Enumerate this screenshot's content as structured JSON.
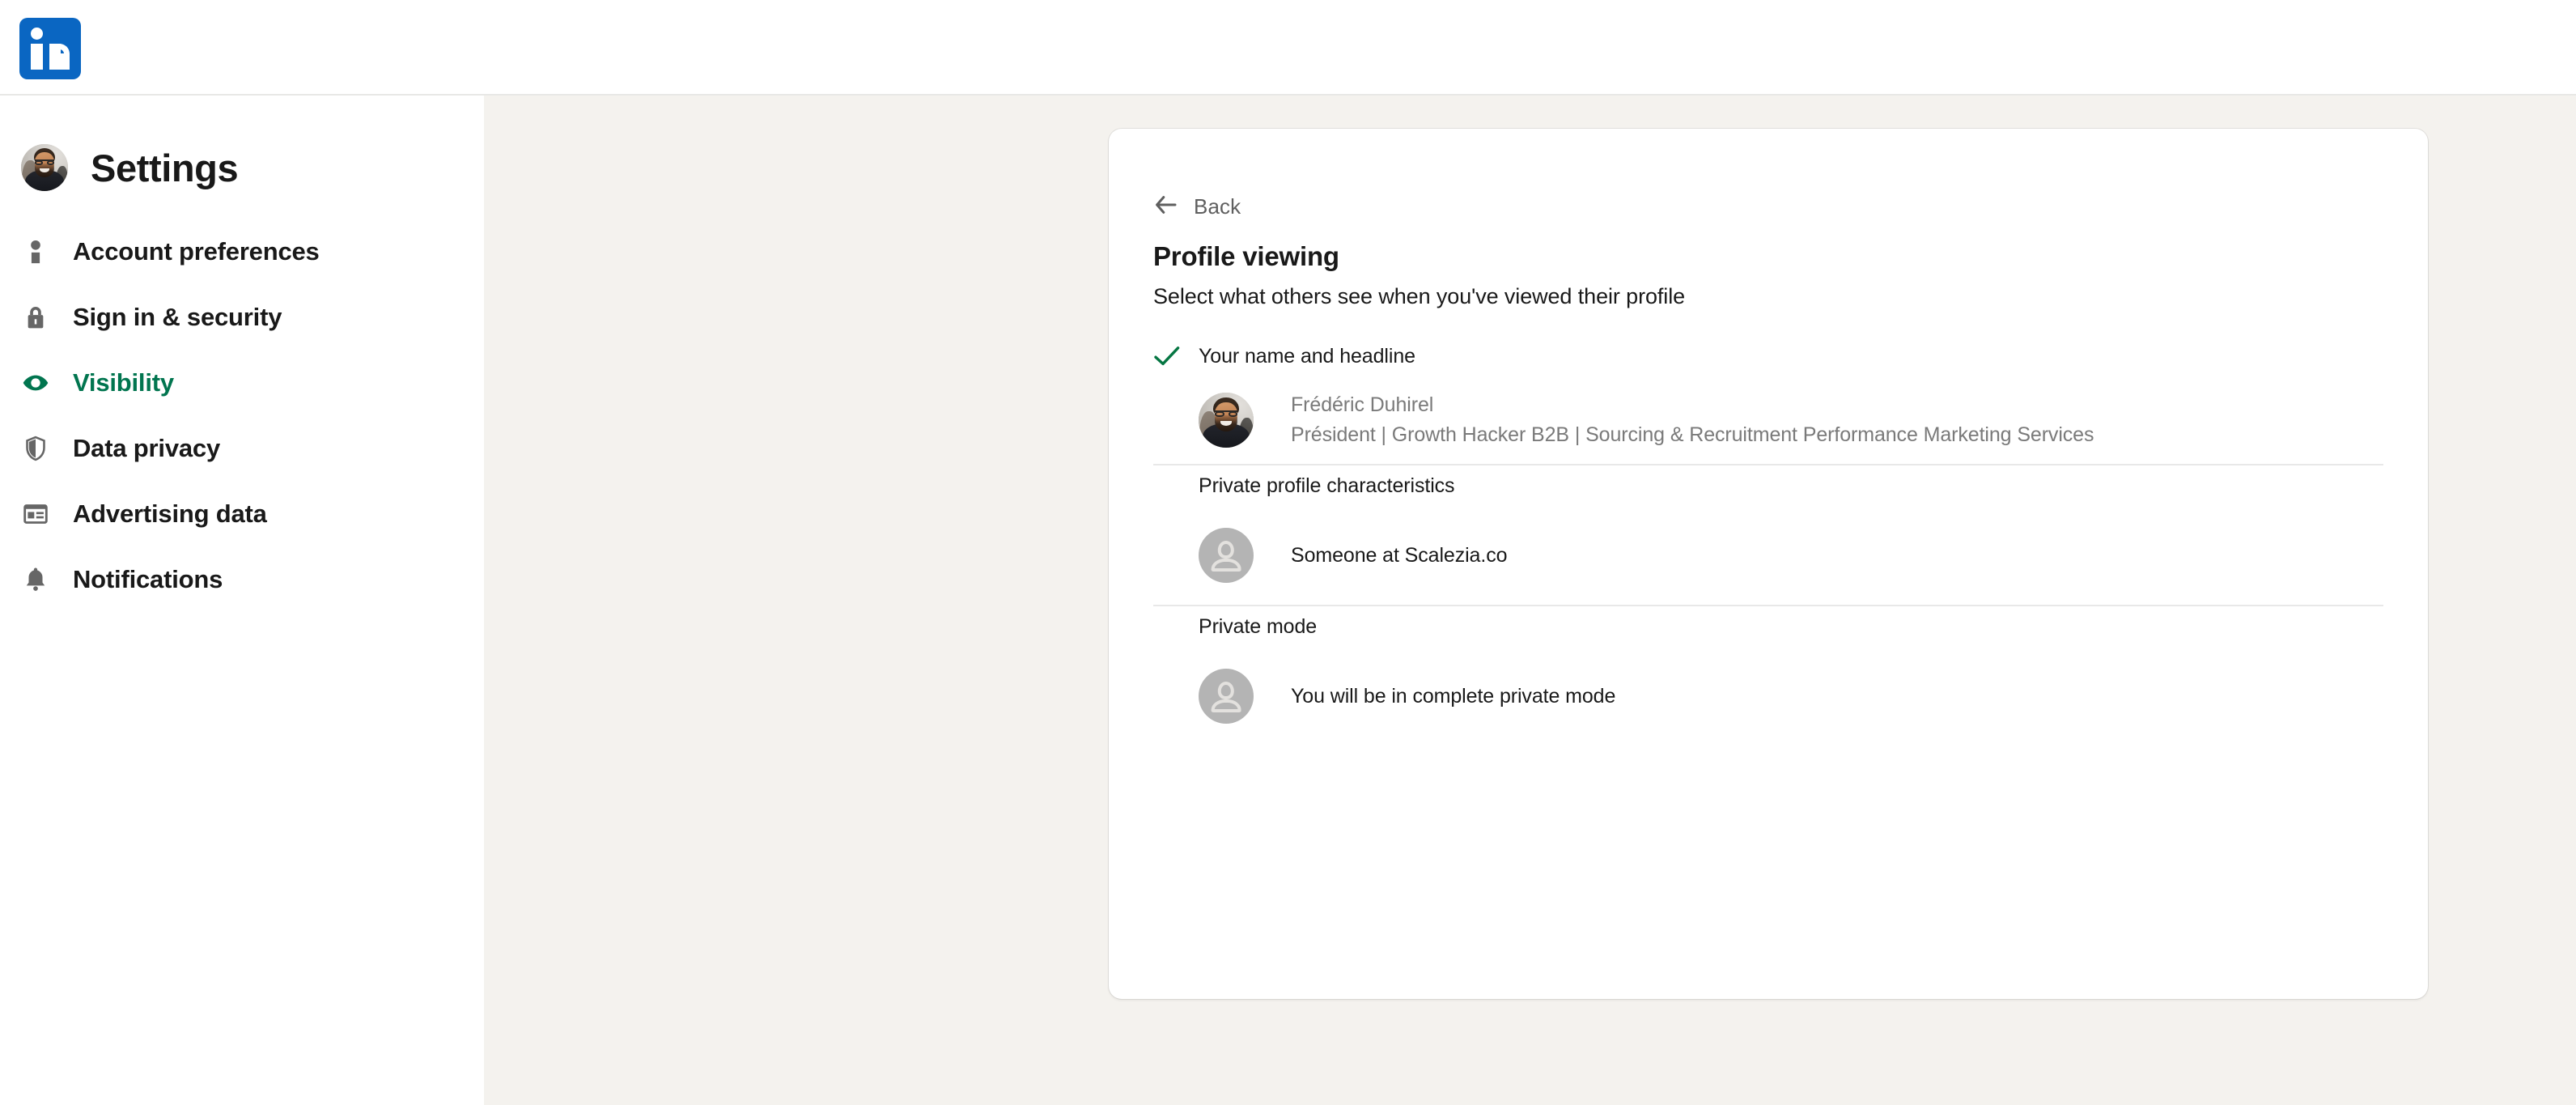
{
  "topbar": {
    "logo_icon": "linkedin-logo-icon",
    "logo_alt": "LinkedIn"
  },
  "sidebar": {
    "title": "Settings",
    "avatar_icon": "user-avatar",
    "items": [
      {
        "label": "Account preferences",
        "icon": "person-icon",
        "active": false
      },
      {
        "label": "Sign in & security",
        "icon": "lock-icon",
        "active": false
      },
      {
        "label": "Visibility",
        "icon": "eye-icon",
        "active": true
      },
      {
        "label": "Data privacy",
        "icon": "shield-icon",
        "active": false
      },
      {
        "label": "Advertising data",
        "icon": "ad-card-icon",
        "active": false
      },
      {
        "label": "Notifications",
        "icon": "bell-icon",
        "active": false
      }
    ]
  },
  "card": {
    "back_label": "Back",
    "back_icon": "arrow-left-icon",
    "title": "Profile viewing",
    "subtitle": "Select what others see when you've viewed their profile",
    "options": [
      {
        "title": "Your name and headline",
        "selected": true,
        "check_icon": "checkmark-icon",
        "avatar_icon": "user-photo-avatar",
        "identity_name": "Frédéric Duhirel",
        "identity_headline": "Président | Growth Hacker B2B | Sourcing & Recruitment Performance Marketing Services"
      },
      {
        "title": "Private profile characteristics",
        "selected": false,
        "avatar_icon": "anonymous-avatar-icon",
        "preview_label": "Someone at Scalezia.co"
      },
      {
        "title": "Private mode",
        "selected": false,
        "avatar_icon": "anonymous-avatar-icon",
        "preview_label": "You will be in complete private mode"
      }
    ]
  },
  "colors": {
    "brand_blue": "#0a66c2",
    "accent_green": "#01754f",
    "check_green": "#057642",
    "page_background": "#f4f2ee",
    "card_background": "#ffffff",
    "text_primary": "#191919",
    "text_muted": "#7a7a7a"
  }
}
